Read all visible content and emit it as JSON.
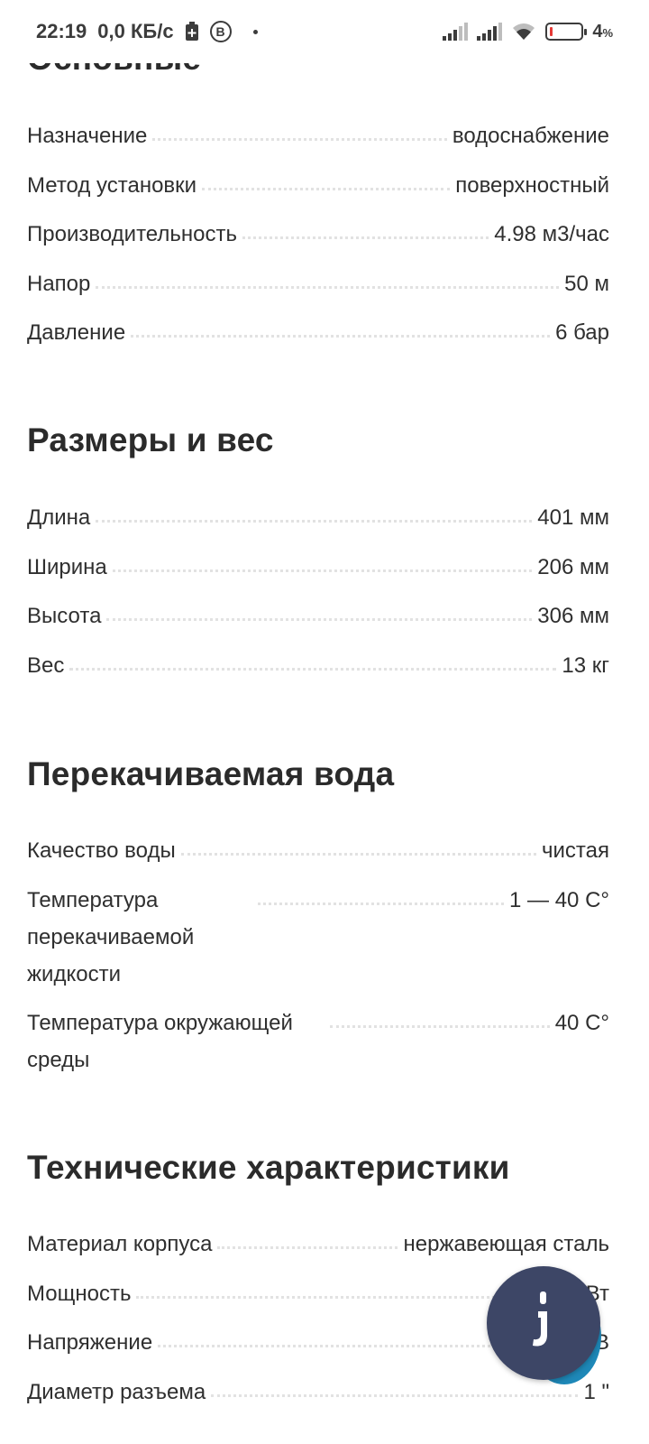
{
  "status_bar": {
    "time": "22:19",
    "speed": "0,0 КБ/с",
    "b_badge": "B",
    "battery_percent": "4",
    "battery_unit": "%"
  },
  "sections": {
    "main": {
      "title": "Основные",
      "rows": [
        {
          "label": "Назначение",
          "value": "водоснабжение"
        },
        {
          "label": "Метод установки",
          "value": "поверхностный"
        },
        {
          "label": "Производительность",
          "value": "4.98 м3/час"
        },
        {
          "label": "Напор",
          "value": "50 м"
        },
        {
          "label": "Давление",
          "value": "6 бар"
        }
      ]
    },
    "size": {
      "title": "Размеры и вес",
      "rows": [
        {
          "label": "Длина",
          "value": "401 мм"
        },
        {
          "label": "Ширина",
          "value": "206 мм"
        },
        {
          "label": "Высота",
          "value": "306 мм"
        },
        {
          "label": "Вес",
          "value": "13 кг"
        }
      ]
    },
    "water": {
      "title": "Перекачиваемая вода",
      "rows": [
        {
          "label": "Качество воды",
          "value": "чистая"
        },
        {
          "label": "Температура перекачиваемой жидкости",
          "value": "1 — 40 C°"
        },
        {
          "label": "Температура окружающей среды",
          "value": "40 C°"
        }
      ]
    },
    "tech": {
      "title": "Технические характеристики",
      "rows": [
        {
          "label": "Материал корпуса",
          "value": "нержавеющая сталь"
        },
        {
          "label": "Мощность",
          "value": "Вт"
        },
        {
          "label": "Напряжение",
          "value": "2 В"
        },
        {
          "label": "Диаметр разъема",
          "value": "1 \""
        }
      ]
    }
  },
  "colors": {
    "fab": "#3d4666",
    "fab_accent": "#1e88b8",
    "battery_low": "#e53935"
  },
  "icons": {
    "fab": "chat-assistant-icon",
    "signal": "cell-signal-icon",
    "wifi": "wifi-icon"
  }
}
